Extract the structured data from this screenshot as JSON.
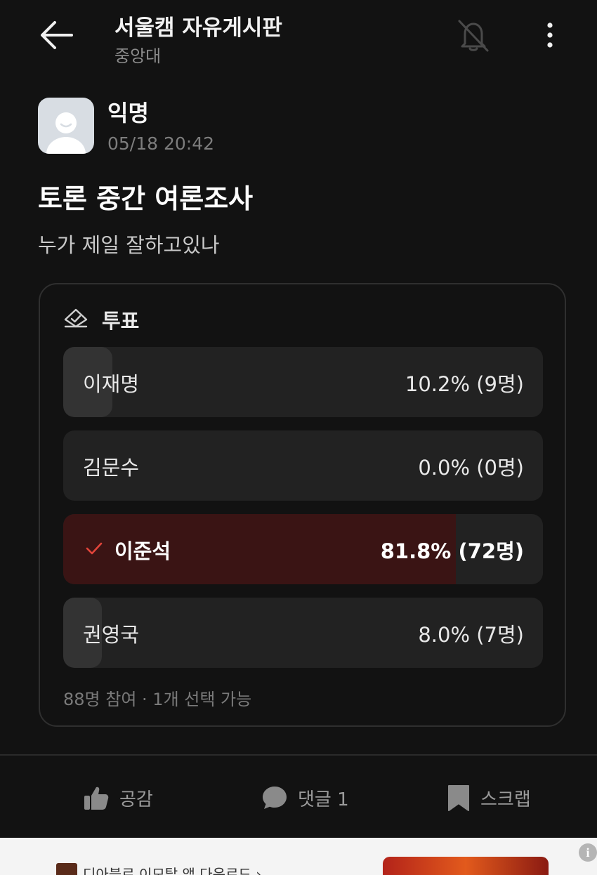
{
  "header": {
    "title": "서울캠 자유게시판",
    "subtitle": "중앙대",
    "back_icon": "arrow-left-icon",
    "notify_icon": "bell-off-icon",
    "more_icon": "more-vertical-icon"
  },
  "post": {
    "author": "익명",
    "timestamp": "05/18 20:42",
    "title": "토론 중간 여론조사",
    "body": "누가 제일 잘하고있나"
  },
  "poll": {
    "label": "투표",
    "options": [
      {
        "name": "이재명",
        "result": "10.2% (9명)",
        "percent": 10.2,
        "selected": false
      },
      {
        "name": "김문수",
        "result": "0.0% (0명)",
        "percent": 0.0,
        "selected": false
      },
      {
        "name": "이준석",
        "result": "81.8% (72명)",
        "percent": 81.8,
        "selected": true
      },
      {
        "name": "권영국",
        "result": "8.0% (7명)",
        "percent": 8.0,
        "selected": false
      }
    ],
    "footer": "88명 참여 · 1개 선택 가능"
  },
  "actions": {
    "like_label": "공감",
    "comment_label": "댓글 1",
    "scrap_label": "스크랩"
  },
  "ad": {
    "text": "디아블로 이모탈 앱 다운로드 ›",
    "info": "i"
  },
  "colors": {
    "background": "#121212",
    "selected_fill": "#3a1414",
    "check": "#e0443a"
  }
}
